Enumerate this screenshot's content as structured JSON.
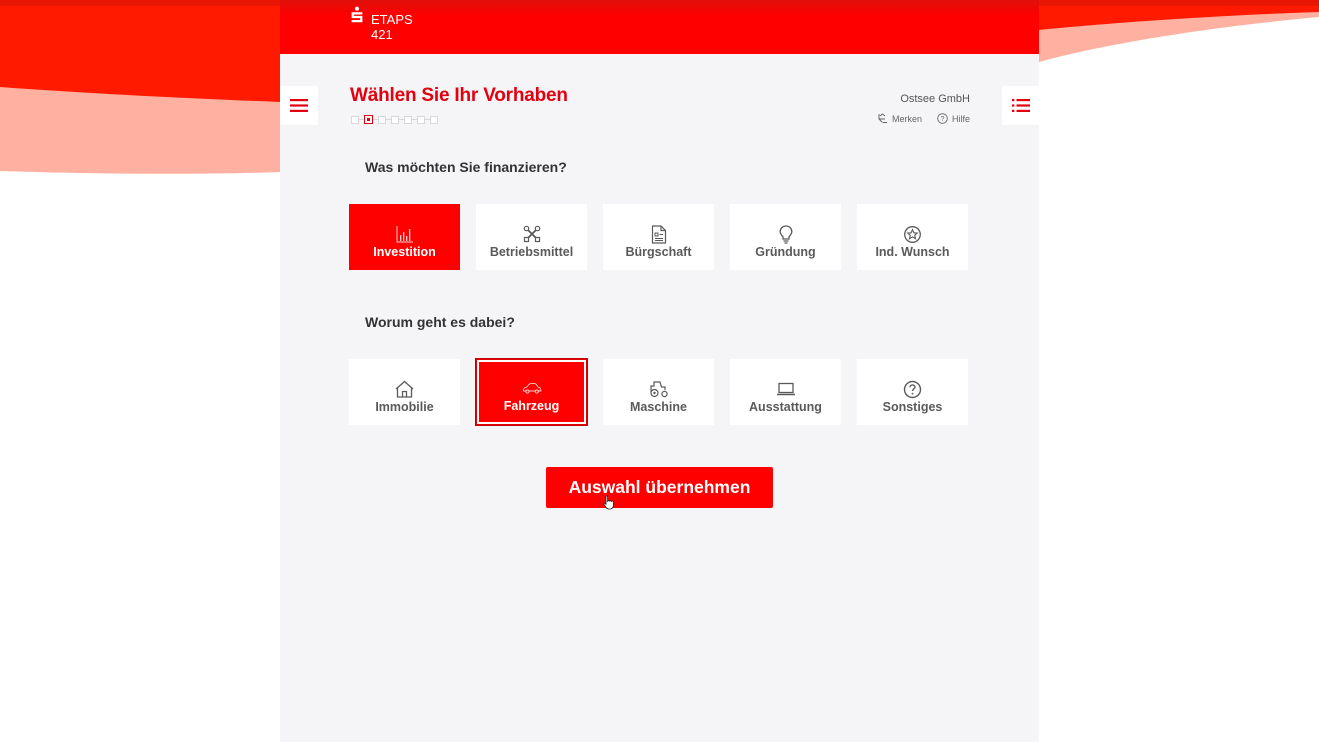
{
  "brand": {
    "line1": "ETAPS",
    "line2": "421",
    "color": "#ff0000"
  },
  "page": {
    "title": "Wählen Sie Ihr Vorhaben",
    "steps_total": 7,
    "step_current": 2
  },
  "account": {
    "company": "Ostsee GmbH"
  },
  "toolbar": {
    "merken": "Merken",
    "hilfe": "Hilfe"
  },
  "section1": {
    "question": "Was möchten Sie finanzieren?",
    "tiles": [
      {
        "label": "Investition",
        "icon": "chart-icon",
        "selected": true
      },
      {
        "label": "Betriebsmittel",
        "icon": "tools-icon",
        "selected": false
      },
      {
        "label": "Bürgschaft",
        "icon": "document-icon",
        "selected": false
      },
      {
        "label": "Gründung",
        "icon": "lightbulb-icon",
        "selected": false
      },
      {
        "label": "Ind. Wunsch",
        "icon": "star-badge-icon",
        "selected": false
      }
    ]
  },
  "section2": {
    "question": "Worum geht es dabei?",
    "tiles": [
      {
        "label": "Immobilie",
        "icon": "house-icon",
        "selected": false
      },
      {
        "label": "Fahrzeug",
        "icon": "car-icon",
        "selected": true
      },
      {
        "label": "Maschine",
        "icon": "tractor-icon",
        "selected": false
      },
      {
        "label": "Ausstattung",
        "icon": "laptop-icon",
        "selected": false
      },
      {
        "label": "Sonstiges",
        "icon": "question-icon",
        "selected": false
      }
    ]
  },
  "cta": {
    "label": "Auswahl übernehmen"
  }
}
